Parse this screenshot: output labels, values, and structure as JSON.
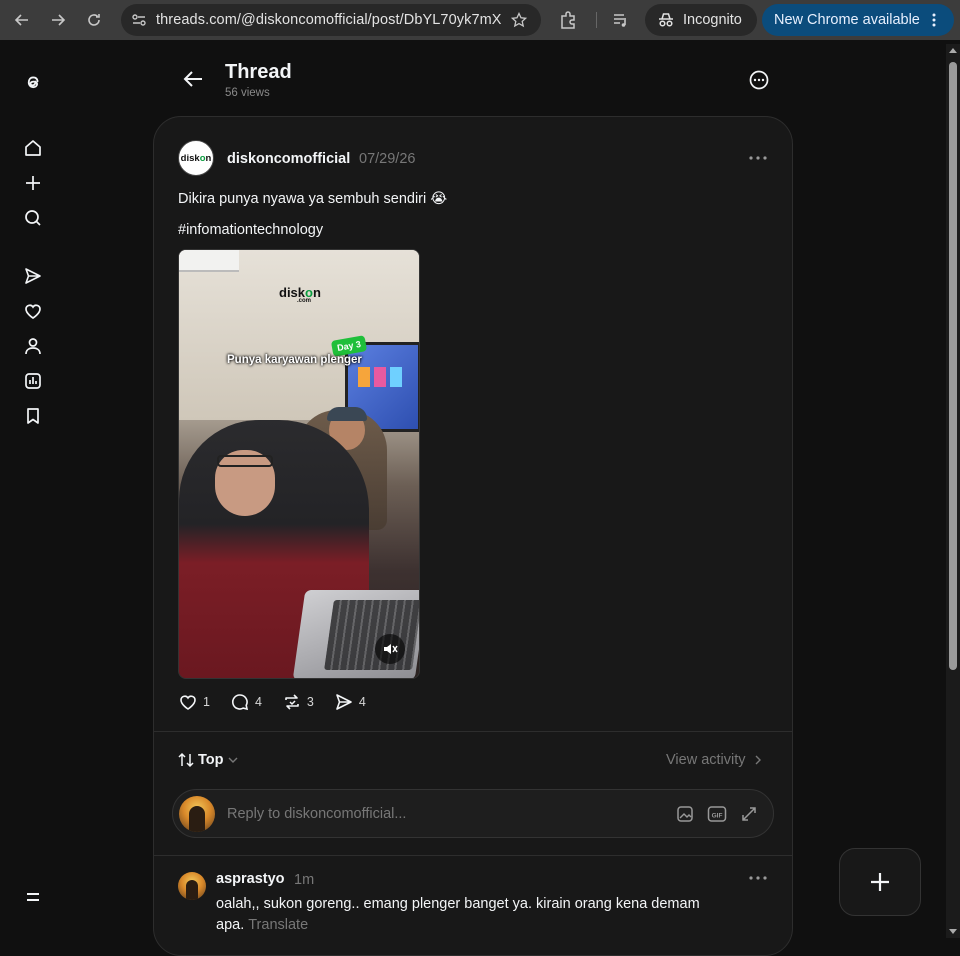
{
  "browser": {
    "url": "threads.com/@diskoncomofficial/post/DbYL70yk7mX",
    "incognito_label": "Incognito",
    "update_label": "New Chrome available"
  },
  "header": {
    "title": "Thread",
    "views": "56 views"
  },
  "post": {
    "username": "diskoncomofficial",
    "date": "07/29/26",
    "text": "Dikira punya nyawa ya sembuh sendiri 😭",
    "hashtag": "#infomationtechnology",
    "media": {
      "brand": "disk",
      "brand_o": "o",
      "brand_n": "n",
      "brand_sub": ".com",
      "day_badge": "Day 3",
      "caption": "Punya karyawan plenger"
    },
    "stats": {
      "likes": "1",
      "replies": "4",
      "reposts": "3",
      "shares": "4"
    }
  },
  "replies_section": {
    "sort_label": "Top",
    "view_activity": "View activity",
    "reply_placeholder": "Reply to diskoncomofficial..."
  },
  "comment": {
    "username": "asprastyo",
    "time": "1m",
    "text": "oalah,, sukon goreng.. emang plenger banget ya. kirain orang kena demam apa.",
    "translate": "Translate"
  },
  "colors": {
    "background": "#101010",
    "card": "#181818",
    "update_button": "#0b4c7c",
    "muted_text": "#777777"
  }
}
